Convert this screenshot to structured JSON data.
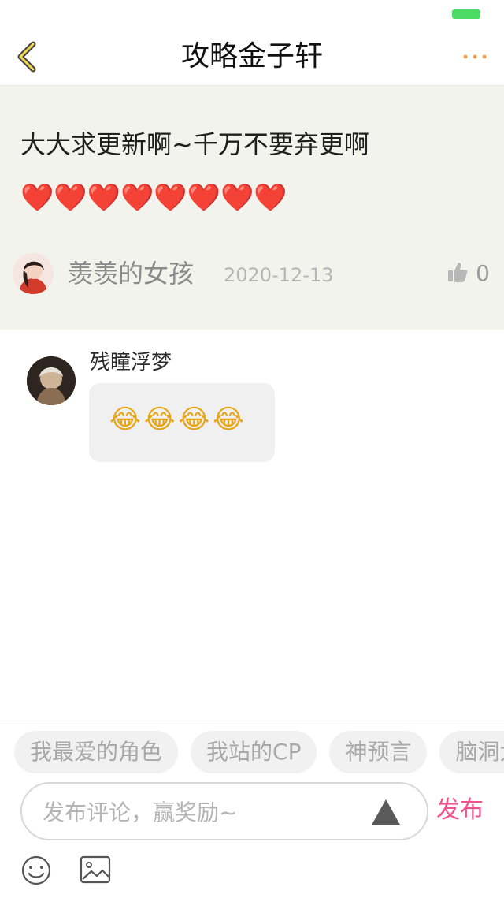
{
  "status_bar": {
    "battery_color": "#4cd964"
  },
  "nav": {
    "title": "攻略金子轩",
    "back_icon": "chevron-left-icon",
    "more_icon": "more-dots-icon",
    "accent_color": "#f0a050"
  },
  "post": {
    "text": "大大求更新啊~千万不要弃更啊",
    "hearts": "❤️❤️❤️❤️❤️❤️❤️❤️",
    "author": {
      "name": "羡羡的女孩",
      "date": "2020-12-13",
      "avatar_icon": "avatar"
    },
    "likes": {
      "icon": "thumbs-up-icon",
      "count": "0"
    },
    "background_color": "#f3f3ee"
  },
  "reply": {
    "name": "残瞳浮梦",
    "content": "😂😂😂😂",
    "avatar_icon": "avatar"
  },
  "tags": [
    "我最爱的角色",
    "我站的CP",
    "神预言",
    "脑洞大开"
  ],
  "composer": {
    "placeholder": "发布评论，赢奖励~",
    "publish_label": "发布",
    "publish_color": "#f0528b",
    "emoji_icon": "emoji-smile-icon",
    "image_icon": "image-icon",
    "triangle_icon": "triangle-icon"
  }
}
